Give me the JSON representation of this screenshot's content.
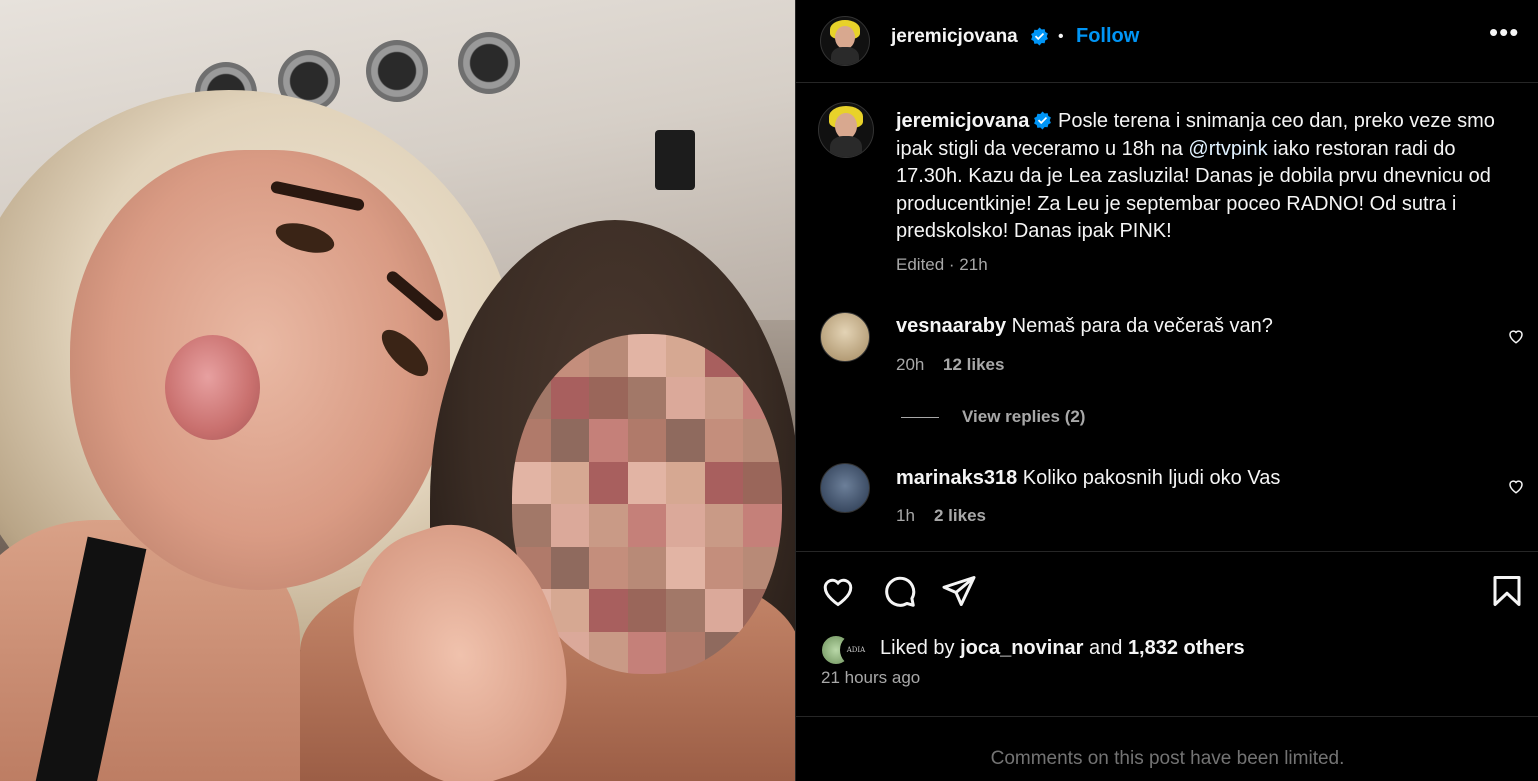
{
  "post": {
    "username": "jeremicjovana",
    "follow_label": "Follow",
    "more_label": "•••",
    "dot": "•",
    "caption_text_1": "Posle terena i snimanja ceo dan, preko veze smo ipak stigli da veceramo u 18h na ",
    "caption_mention": "@rtvpink",
    "caption_text_2": " iako restoran radi do 17.30h. Kazu da je Lea zasluzila! Danas je dobila prvu dnevnicu od producentkinje! Za Leu je septembar poceo RADNO! Od sutra i predskolsko! Danas ipak PINK!",
    "edited_label": "Edited · 21h"
  },
  "comments": [
    {
      "username": "vesnaaraby",
      "text": "Nemaš para da večeraš van?",
      "time": "20h",
      "likes": "12 likes"
    },
    {
      "username": "marinaks318",
      "text": "Koliko pakosnih ljudi oko Vas",
      "time": "1h",
      "likes": "2 likes"
    }
  ],
  "view_replies": "View replies (2)",
  "likes": {
    "prefix": "Liked by ",
    "user": "joca_novinar",
    "middle": " and ",
    "others": "1,832 others",
    "mini_avatar_text": "ADIA"
  },
  "timestamp": "21 hours ago",
  "comments_limited": "Comments on this post have been limited.",
  "colors": {
    "accent": "#0095f6",
    "verified": "#0095f6",
    "background": "#000000",
    "muted": "#a8a8a8"
  },
  "icons": [
    "more-icon",
    "verified-icon",
    "heart-icon",
    "comment-icon",
    "share-icon",
    "save-icon"
  ]
}
